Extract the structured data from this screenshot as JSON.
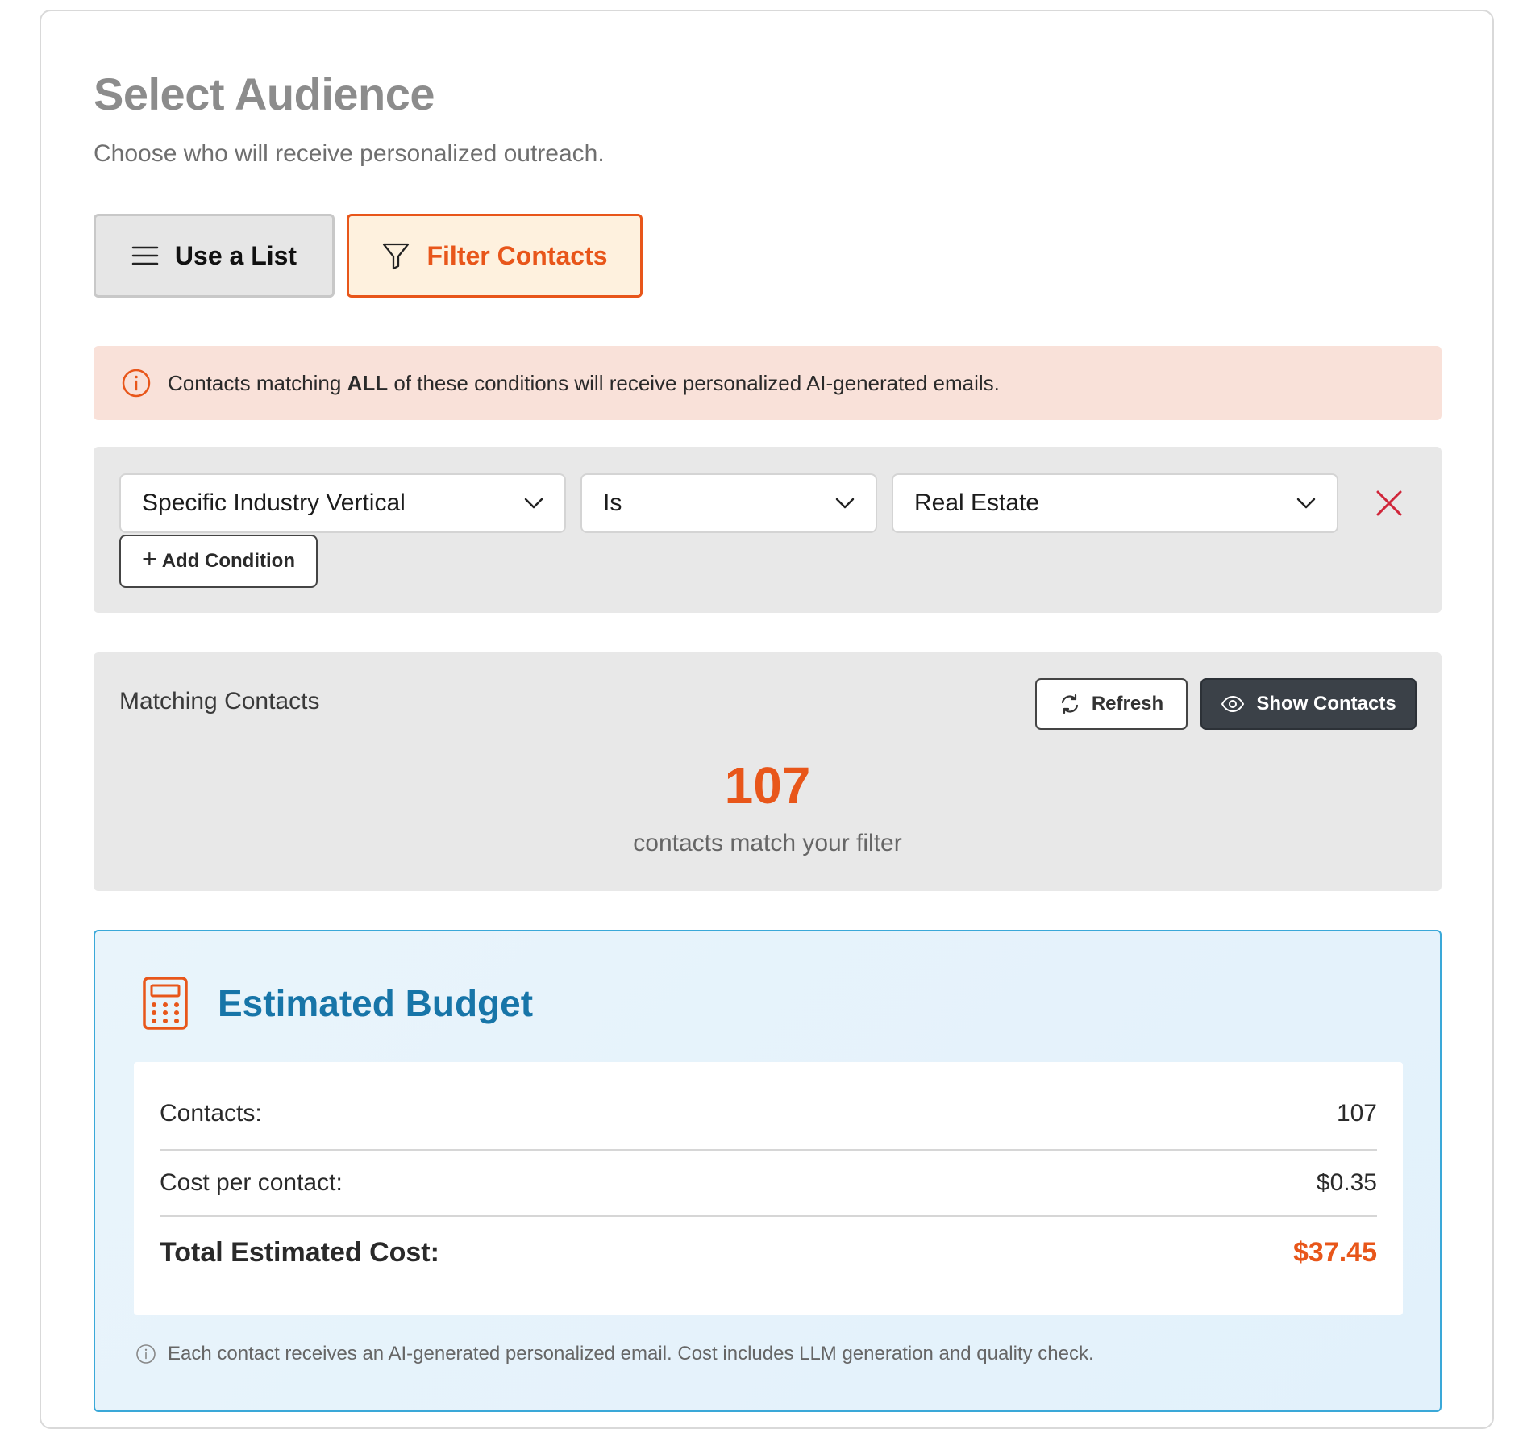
{
  "header": {
    "title": "Select Audience",
    "subtitle": "Choose who will receive personalized outreach."
  },
  "mode_toggle": {
    "use_list_label": "Use a List",
    "filter_contacts_label": "Filter Contacts",
    "selected": "Filter Contacts"
  },
  "info_banner": {
    "prefix": "Contacts matching ",
    "emphasis": "ALL",
    "suffix": " of these conditions will receive personalized AI-generated emails."
  },
  "conditions": {
    "items": [
      {
        "field": "Specific Industry Vertical",
        "operator": "Is",
        "value": "Real Estate"
      }
    ],
    "add_label": "Add Condition"
  },
  "matching": {
    "title": "Matching Contacts",
    "refresh_label": "Refresh",
    "show_label": "Show Contacts",
    "count": "107",
    "caption": "contacts match your filter"
  },
  "budget": {
    "title": "Estimated Budget",
    "rows": [
      {
        "label": "Contacts:",
        "value": "107"
      },
      {
        "label": "Cost per contact:",
        "value": "$0.35"
      },
      {
        "label": "Total Estimated Cost:",
        "value": "$37.45"
      }
    ],
    "note": "Each contact receives an AI-generated personalized email. Cost includes LLM generation and quality check."
  },
  "colors": {
    "accent": "#e8561a",
    "budget_title": "#1775a8",
    "budget_border": "#3aa8d8",
    "remove": "#d0263a"
  }
}
